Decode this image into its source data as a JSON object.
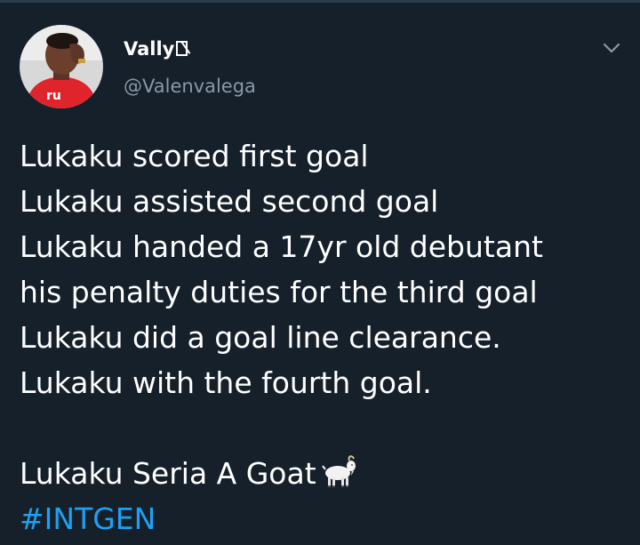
{
  "tweet": {
    "author": {
      "display_name": "Vally",
      "name_emoji_icon": "missing-glyph-box-icon",
      "handle": "@Valenvalega",
      "avatar_icon": "user-avatar-photo"
    },
    "menu_icon": "chevron-down-icon",
    "lines": [
      "Lukaku scored first goal",
      "Lukaku assisted second goal",
      "Lukaku handed a 17yr old debutant",
      "his penalty duties for the third goal",
      "Lukaku did a goal line clearance.",
      "Lukaku with the fourth goal."
    ],
    "closing_line": "Lukaku Seria A Goat",
    "closing_emoji_icon": "goat-icon",
    "hashtag": "#INTGEN"
  },
  "colors": {
    "background": "#15202b",
    "text_primary": "#ffffff",
    "text_secondary": "#8899a6",
    "link": "#1da1f2"
  }
}
